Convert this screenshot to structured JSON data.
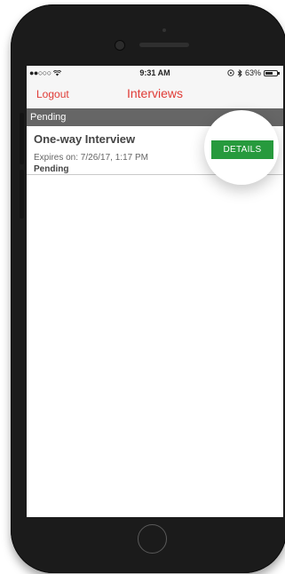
{
  "status_bar": {
    "signal": "●●○○○",
    "wifi_icon": "wifi-icon",
    "time": "9:31 AM",
    "orientation_lock_icon": "orientation-lock-icon",
    "bluetooth_icon": "bluetooth-icon",
    "battery_percent": "63%",
    "battery_level": 0.63
  },
  "nav": {
    "logout_label": "Logout",
    "title": "Interviews"
  },
  "section": {
    "header": "Pending"
  },
  "interview": {
    "title": "One-way Interview",
    "expires": "Expires on: 7/26/17, 1:17 PM",
    "status": "Pending",
    "details_label": "DETAILS"
  },
  "colors": {
    "accent": "#e03b36",
    "details_button": "#279a3d",
    "section_header": "#666666"
  }
}
